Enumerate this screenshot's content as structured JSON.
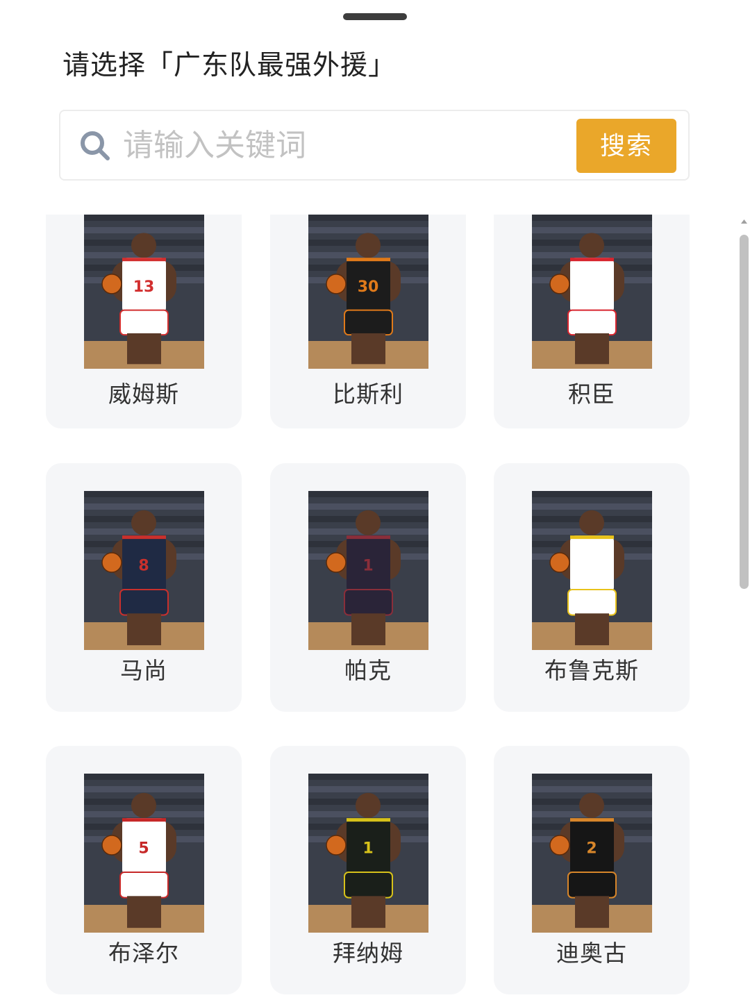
{
  "sheet": {
    "title": "请选择「广东队最强外援」"
  },
  "search": {
    "placeholder": "请输入关键词",
    "value": "",
    "button_label": "搜索"
  },
  "players": [
    {
      "name": "威姆斯",
      "jersey_color": "#ffffff",
      "accent": "#d22f2f",
      "number": "13"
    },
    {
      "name": "比斯利",
      "jersey_color": "#1c1c1c",
      "accent": "#e07a1a",
      "number": "30"
    },
    {
      "name": "积臣",
      "jersey_color": "#ffffff",
      "accent": "#d8252e",
      "number": ""
    },
    {
      "name": "马尚",
      "jersey_color": "#1f2a44",
      "accent": "#c9302c",
      "number": "8"
    },
    {
      "name": "帕克",
      "jersey_color": "#2a2438",
      "accent": "#8a2e3a",
      "number": "1"
    },
    {
      "name": "布鲁克斯",
      "jersey_color": "#ffffff",
      "accent": "#e8c21a",
      "number": ""
    },
    {
      "name": "布泽尔",
      "jersey_color": "#ffffff",
      "accent": "#c62828",
      "number": "5"
    },
    {
      "name": "拜纳姆",
      "jersey_color": "#1a1f1a",
      "accent": "#d7c21a",
      "number": "1"
    },
    {
      "name": "迪奥古",
      "jersey_color": "#161616",
      "accent": "#d8862a",
      "number": "2"
    }
  ],
  "colors": {
    "accent": "#eaa72a",
    "card_bg": "#f5f6f8",
    "text": "#222222",
    "placeholder": "#c2c2c2"
  },
  "icons": {
    "search": "search-icon",
    "handle": "drag-handle"
  }
}
